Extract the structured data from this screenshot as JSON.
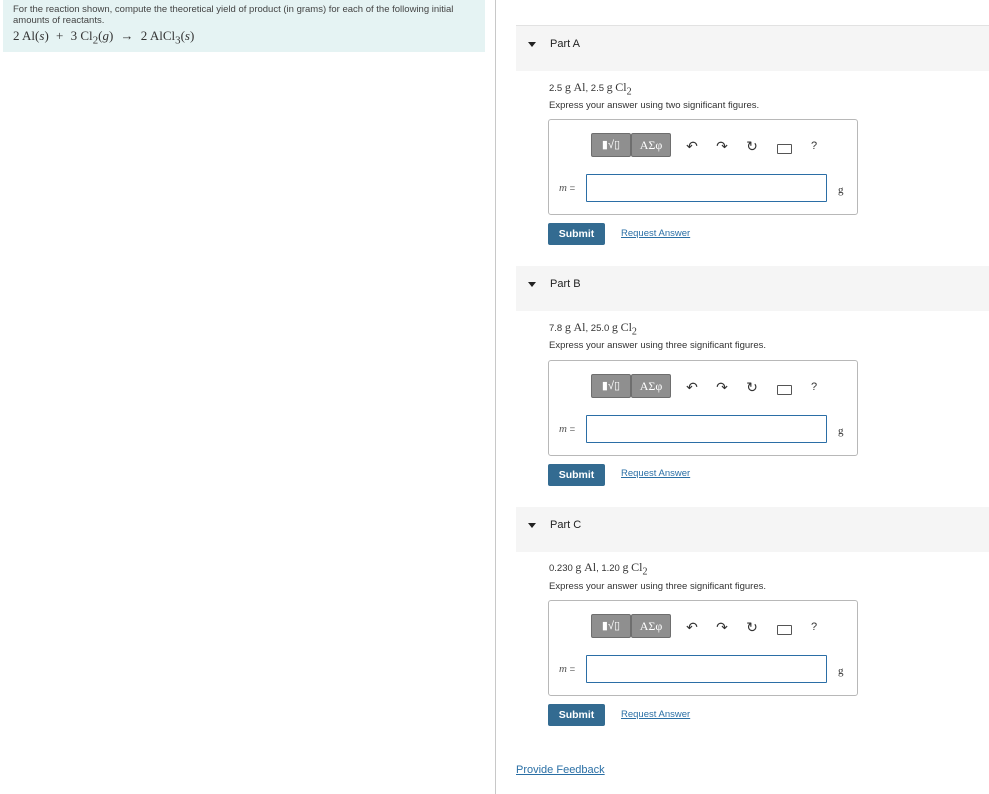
{
  "problem": {
    "text": "For the reaction shown, compute the theoretical yield of product (in grams) for each of the following initial amounts of reactants.",
    "equation": {
      "lhs1_coef": "2",
      "lhs1_el": "Al",
      "lhs1_state": "s",
      "lhs2_coef": "3",
      "lhs2_el": "Cl",
      "lhs2_sub": "2",
      "lhs2_state": "g",
      "rhs_coef": "2",
      "rhs_el": "AlCl",
      "rhs_sub": "3",
      "rhs_state": "s"
    }
  },
  "parts": [
    {
      "title": "Part A",
      "given": {
        "amount1": "2.5",
        "unit1": "g",
        "species1": "Al",
        "amount2": "2.5",
        "unit2": "g",
        "species2": "Cl",
        "sub2": "2"
      },
      "instruction": "Express your answer using two significant figures.",
      "toolbar": {
        "template_label": "▮√▯",
        "greek_label": "ΑΣφ",
        "undo": "↶",
        "redo": "↷",
        "reset": "↻",
        "help": "?"
      },
      "var_label": "m",
      "equals": "=",
      "input": {
        "value": "",
        "placeholder": ""
      },
      "unit": "g",
      "submit_label": "Submit",
      "request_label": "Request Answer"
    },
    {
      "title": "Part B",
      "given": {
        "amount1": "7.8",
        "unit1": "g",
        "species1": "Al",
        "amount2": "25.0",
        "unit2": "g",
        "species2": "Cl",
        "sub2": "2"
      },
      "instruction": "Express your answer using three significant figures.",
      "toolbar": {
        "template_label": "▮√▯",
        "greek_label": "ΑΣφ",
        "undo": "↶",
        "redo": "↷",
        "reset": "↻",
        "help": "?"
      },
      "var_label": "m",
      "equals": "=",
      "input": {
        "value": "",
        "placeholder": ""
      },
      "unit": "g",
      "submit_label": "Submit",
      "request_label": "Request Answer"
    },
    {
      "title": "Part C",
      "given": {
        "amount1": "0.230",
        "unit1": "g",
        "species1": "Al",
        "amount2": "1.20",
        "unit2": "g",
        "species2": "Cl",
        "sub2": "2"
      },
      "instruction": "Express your answer using three significant figures.",
      "toolbar": {
        "template_label": "▮√▯",
        "greek_label": "ΑΣφ",
        "undo": "↶",
        "redo": "↷",
        "reset": "↻",
        "help": "?"
      },
      "var_label": "m",
      "equals": "=",
      "input": {
        "value": "",
        "placeholder": ""
      },
      "unit": "g",
      "submit_label": "Submit",
      "request_label": "Request Answer"
    }
  ],
  "feedback_label": "Provide Feedback",
  "colors": {
    "problem_bg": "#e5f3f3",
    "submit_bg": "#336b91",
    "link": "#2a6fa5",
    "input_border": "#2b6ea6"
  },
  "icons": [
    "caret-down-icon",
    "template-icon",
    "greek-symbols-icon",
    "undo-icon",
    "redo-icon",
    "reset-icon",
    "keyboard-icon",
    "help-icon"
  ]
}
